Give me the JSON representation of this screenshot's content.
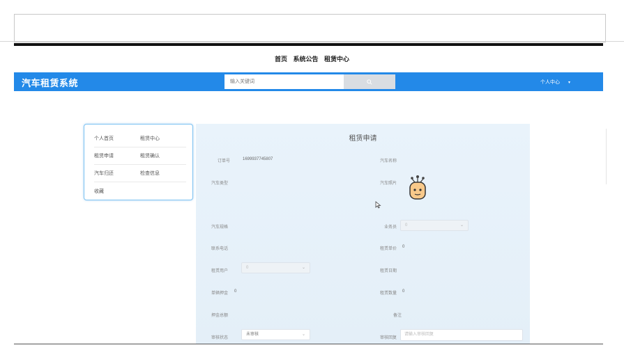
{
  "nav": {
    "home": "首页",
    "announcement": "系统公告",
    "rental_center": "租赁中心"
  },
  "header": {
    "brand": "汽车租赁系统",
    "search_placeholder": "输入关键词",
    "user_label": "个人中心",
    "accent_color": "#2389e8"
  },
  "sidebar": {
    "items": [
      {
        "label": "个人首页"
      },
      {
        "label": "租赁中心"
      },
      {
        "label": "租赁申请"
      },
      {
        "label": "租赁确认"
      },
      {
        "label": "汽车归还"
      },
      {
        "label": "检查信息"
      },
      {
        "label": "收藏"
      }
    ]
  },
  "form": {
    "title": "租赁申请",
    "order_no_label": "订单号",
    "order_no_value": "1699937745807",
    "car_name_label": "汽车名称",
    "car_type_label": "汽车类型",
    "car_photo_label": "汽车照片",
    "car_spec_label": "汽车规格",
    "salesman_label": "业务员",
    "salesman_value": "0",
    "phone_label": "联系电话",
    "unit_price_label": "租赁单价",
    "unit_price_value": "0",
    "rental_user_label": "租赁用户",
    "rental_user_value": "0",
    "rental_date_label": "租赁日期",
    "deposit_label": "单辆押金",
    "deposit_value": "0",
    "quantity_label": "租赁数量",
    "quantity_value": "0",
    "total_deposit_label": "押金总额",
    "remark_label": "备注",
    "review_status_label": "审核状态",
    "review_status_value": "未审核",
    "review_reply_label": "审核回复",
    "review_reply_placeholder": "请输入审核回复"
  }
}
